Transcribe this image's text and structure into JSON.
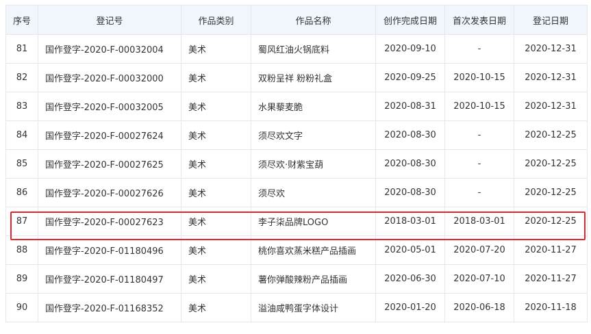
{
  "table": {
    "headers": [
      "序号",
      "登记号",
      "作品类别",
      "作品名称",
      "创作完成日期",
      "首次发表日期",
      "登记日期"
    ],
    "rows": [
      [
        "81",
        "国作登字-2020-F-00032004",
        "美术",
        "蜀风红油火锅底料",
        "2020-09-10",
        "-",
        "2020-12-31"
      ],
      [
        "82",
        "国作登字-2020-F-00032000",
        "美术",
        "双粉呈祥 粉粉礼盒",
        "2020-09-25",
        "2020-10-15",
        "2020-12-31"
      ],
      [
        "83",
        "国作登字-2020-F-00032005",
        "美术",
        "水果藜麦脆",
        "2020-08-31",
        "2020-10-15",
        "2020-12-31"
      ],
      [
        "84",
        "国作登字-2020-F-00027624",
        "美术",
        "须尽欢文字",
        "2020-08-30",
        "-",
        "2020-12-25"
      ],
      [
        "85",
        "国作登字-2020-F-00027625",
        "美术",
        "须尽欢·财紫宝葫",
        "2020-08-30",
        "-",
        "2020-12-25"
      ],
      [
        "86",
        "国作登字-2020-F-00027626",
        "美术",
        "须尽欢",
        "2020-08-30",
        "-",
        "2020-12-25"
      ],
      [
        "87",
        "国作登字-2020-F-00027623",
        "美术",
        "李子柒品牌LOGO",
        "2018-03-01",
        "2018-03-01",
        "2020-12-25"
      ],
      [
        "88",
        "国作登字-2020-F-01180496",
        "美术",
        "桃你喜欢蒸米糕产品插画",
        "2020-05-01",
        "2020-07-20",
        "2020-11-27"
      ],
      [
        "89",
        "国作登字-2020-F-01180497",
        "美术",
        "薯你弹酸辣粉产品插画",
        "2020-06-30",
        "2020-07-10",
        "2020-11-27"
      ],
      [
        "90",
        "国作登字-2020-F-01168352",
        "美术",
        "溢油咸鸭蛋字体设计",
        "2020-01-20",
        "2020-06-18",
        "2020-11-18"
      ]
    ],
    "highlighted_row": "87"
  },
  "colors": {
    "header_bg": "#f1f6fd",
    "border": "#e4e7ee",
    "highlight": "#e8242b"
  }
}
